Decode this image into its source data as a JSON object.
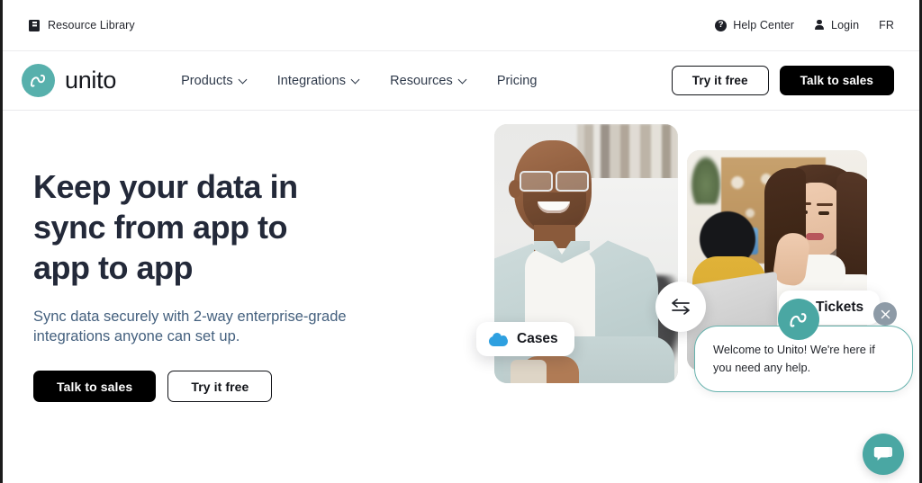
{
  "utility_bar": {
    "resource_library": "Resource Library",
    "resource_library_icon": "book-icon",
    "help_center": "Help Center",
    "help_icon": "question-circle-icon",
    "login": "Login",
    "login_icon": "person-icon",
    "language": "FR"
  },
  "header": {
    "logo_text": "unito",
    "logo_icon": "unito-wave-icon",
    "nav": [
      {
        "label": "Products",
        "has_dropdown": true
      },
      {
        "label": "Integrations",
        "has_dropdown": true
      },
      {
        "label": "Resources",
        "has_dropdown": true
      },
      {
        "label": "Pricing",
        "has_dropdown": false
      }
    ],
    "cta_outline": "Try it free",
    "cta_solid": "Talk to sales"
  },
  "hero": {
    "title": "Keep your data in\nsync from app to\napp to app",
    "subtitle": "Sync data securely with 2-way enterprise-grade\nintegrations anyone can set up.",
    "cta_primary": "Talk to sales",
    "cta_secondary": "Try it free"
  },
  "visual": {
    "pill_cases": "Cases",
    "pill_cases_icon": "salesforce-cloud-icon",
    "pill_tickets": "Tickets",
    "pill_tickets_icon": "jira-ticket-icon",
    "sync_icon": "two-way-sync-arrows-icon",
    "left_photo_alt": "Smiling man with glasses in light blue shirt",
    "right_photo_alt": "Woman in white jacket working at a laptop"
  },
  "chat": {
    "message": "Welcome to Unito! We're here if you need any help.",
    "avatar_icon": "unito-wave-icon",
    "close_icon": "close-icon",
    "launcher_icon": "chat-bubbles-icon"
  },
  "colors": {
    "brand_teal": "#4aa7a3",
    "headline": "#232939",
    "subtitle": "#44607e",
    "black": "#000000",
    "salesforce_blue": "#2ea0e0",
    "jira_blue": "#2a72dd"
  }
}
